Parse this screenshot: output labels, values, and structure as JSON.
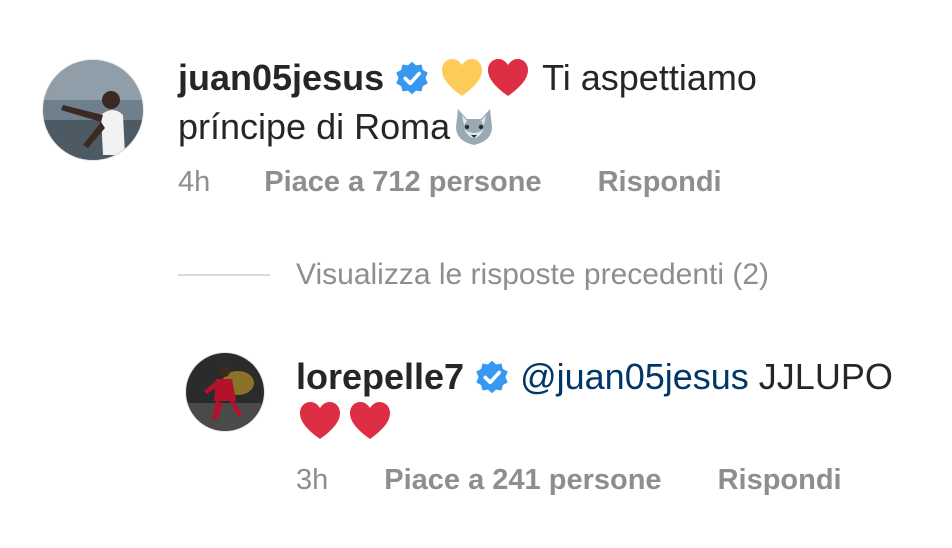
{
  "comment1": {
    "username": "juan05jesus",
    "verified": true,
    "emojis": [
      "yellow-heart",
      "red-heart"
    ],
    "text_line1": "Ti aspettiamo",
    "text_line2": "príncipe di Roma",
    "trailing_emoji": "wolf-face",
    "time": "4h",
    "likes": "Piace a 712 persone",
    "reply": "Rispondi"
  },
  "view_previous": "Visualizza le risposte precedenti (2)",
  "comment2": {
    "username": "lorepelle7",
    "verified": true,
    "mention": "@juan05jesus",
    "text": "JJLUPO",
    "emojis": [
      "red-heart",
      "red-heart"
    ],
    "time": "3h",
    "likes": "Piace a 241 persone",
    "reply": "Rispondi"
  },
  "colors": {
    "text": "#262626",
    "secondary": "#8e8e8e",
    "verified_badge": "#3897f0",
    "mention": "#00376b",
    "red_heart": "#dd2e44",
    "yellow_heart": "#fdcb58"
  }
}
